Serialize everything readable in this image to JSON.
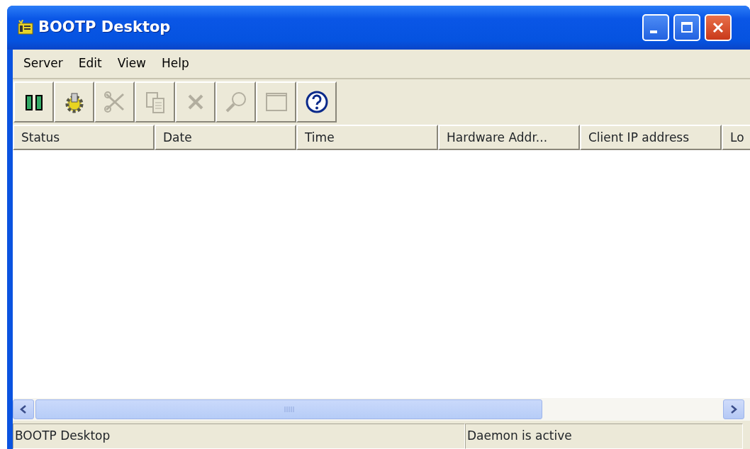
{
  "window": {
    "title": "BOOTP Desktop"
  },
  "menu": [
    "Server",
    "Edit",
    "View",
    "Help"
  ],
  "toolbar": [
    {
      "kind": "pause",
      "disabled": false
    },
    {
      "kind": "gear",
      "disabled": false
    },
    {
      "kind": "scissors",
      "disabled": true
    },
    {
      "kind": "copy",
      "disabled": true
    },
    {
      "kind": "delete",
      "disabled": true
    },
    {
      "kind": "find",
      "disabled": true
    },
    {
      "kind": "window",
      "disabled": true
    },
    {
      "kind": "help",
      "disabled": false
    }
  ],
  "table": {
    "columns": [
      "Status",
      "Date",
      "Time",
      "Hardware Addr...",
      "Client IP address",
      "Lo"
    ]
  },
  "status_bar": [
    "BOOTP Desktop",
    "Daemon is active"
  ]
}
